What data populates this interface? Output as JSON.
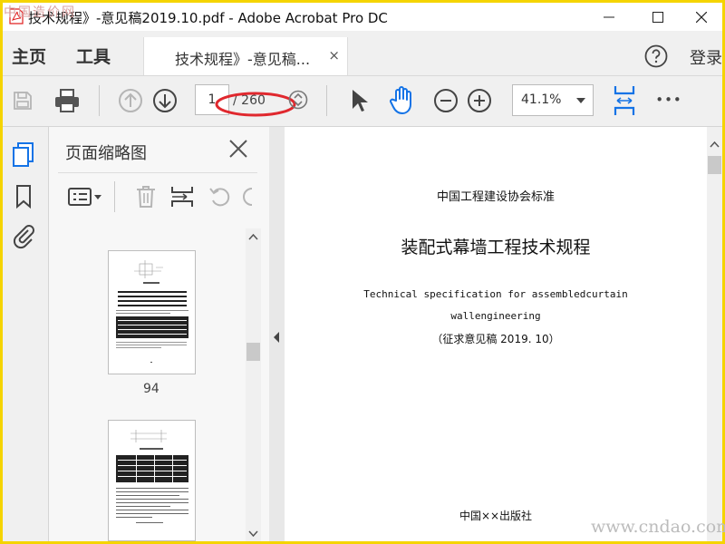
{
  "window": {
    "title": "技术规程》-意见稿2019.10.pdf - Adobe Acrobat Pro DC",
    "minimize": "—",
    "maximize": "☐",
    "close": "✕"
  },
  "tabs": {
    "home": "主页",
    "tools": "工具",
    "document_tab": "技术规程》-意见稿...",
    "document_tab_close": "×",
    "login": "登录"
  },
  "toolbar": {
    "current_page": "1",
    "page_total": "/ 260",
    "zoom": "41.1%",
    "more": "•••"
  },
  "thumbnails_pane": {
    "title": "页面缩略图",
    "pages": [
      {
        "number": "94"
      },
      {
        "number": ""
      }
    ]
  },
  "document": {
    "line1": "中国工程建设协会标准",
    "title": "装配式幕墙工程技术规程",
    "english_line1": "Technical specification for assembledcurtain",
    "english_line2": "wallengineering",
    "status": "（征求意见稿 2019. 10）",
    "publisher": "中国××出版社"
  },
  "watermarks": {
    "top_left": "中国造价网",
    "bottom_right": "www.cndao.com"
  },
  "colors": {
    "outer_border": "#f5d400",
    "accent_blue": "#1473e6",
    "annotation_red": "#e0282e",
    "pdf_red": "#e02020"
  }
}
